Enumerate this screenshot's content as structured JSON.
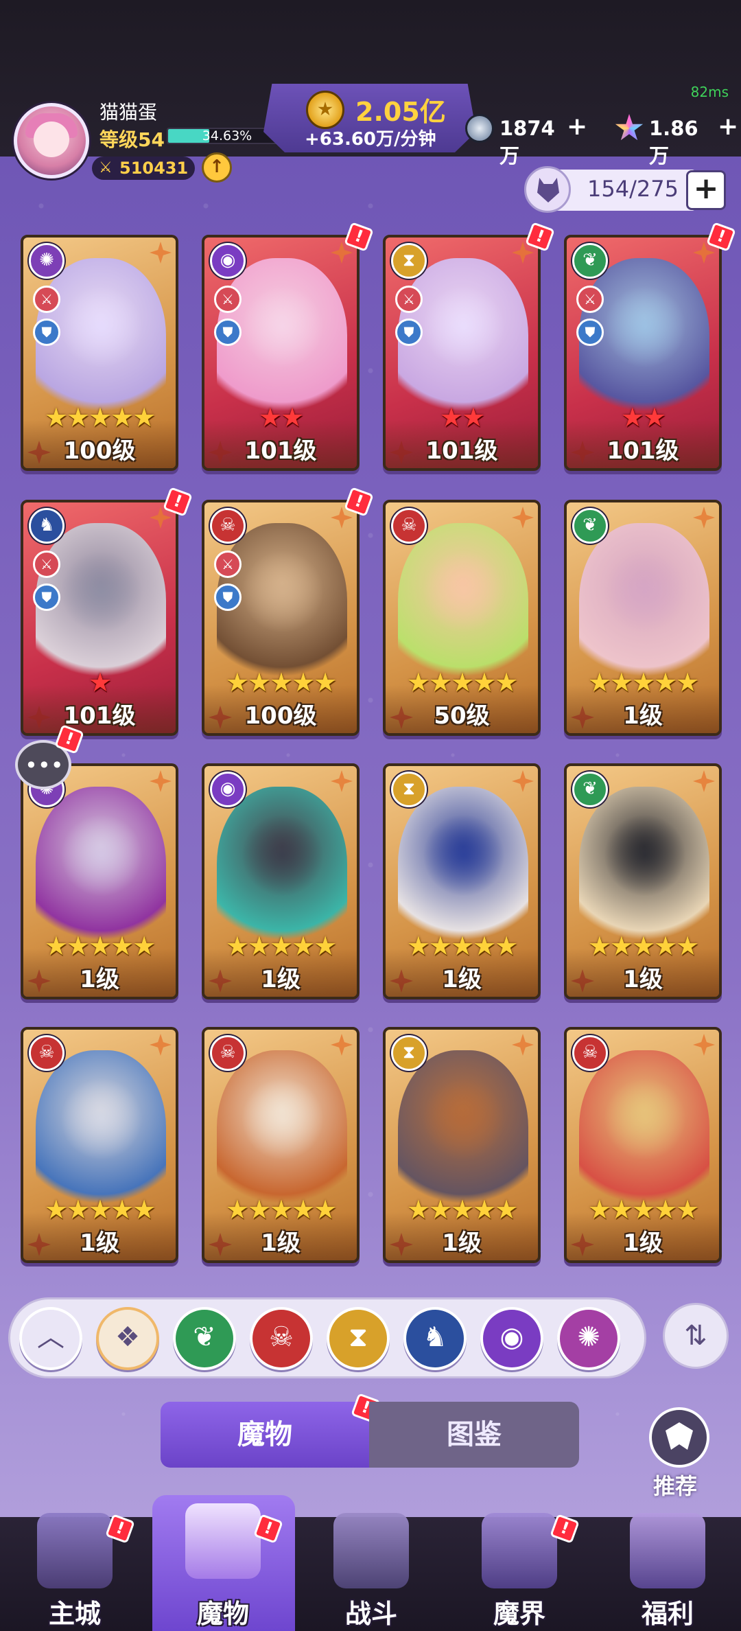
{
  "status": {
    "ping": "82ms"
  },
  "player": {
    "name": "猫猫蛋",
    "level": "等级54",
    "xp_percent": "34.63%",
    "xp_fraction": 0.3463,
    "power": "510431"
  },
  "gold": {
    "amount": "2.05亿",
    "rate": "+63.60万/分钟"
  },
  "resources": [
    {
      "name": "silver-coin",
      "value": "1874万"
    },
    {
      "name": "crystal-star",
      "value": "1.86万"
    }
  ],
  "collection": {
    "count": "154/275"
  },
  "monsters": [
    {
      "element": "vortex",
      "bg": "gold",
      "roles": [
        "atk",
        "def"
      ],
      "stars": 5,
      "star_color": "gold",
      "level": "100级",
      "badge": false
    },
    {
      "element": "eye",
      "bg": "red",
      "roles": [
        "atk",
        "def"
      ],
      "stars": 2,
      "star_color": "red",
      "level": "101级",
      "badge": true
    },
    {
      "element": "hourglass",
      "bg": "red",
      "roles": [
        "atk",
        "def"
      ],
      "stars": 2,
      "star_color": "red",
      "level": "101级",
      "badge": true
    },
    {
      "element": "leaf",
      "bg": "red",
      "roles": [
        "atk",
        "def"
      ],
      "stars": 2,
      "star_color": "red",
      "level": "101级",
      "badge": true
    },
    {
      "element": "dragon",
      "bg": "red",
      "roles": [
        "atk",
        "def"
      ],
      "stars": 1,
      "star_color": "red",
      "level": "101级",
      "badge": true
    },
    {
      "element": "skull",
      "bg": "gold",
      "roles": [
        "atk",
        "def"
      ],
      "stars": 5,
      "star_color": "gold",
      "level": "100级",
      "badge": true
    },
    {
      "element": "skull",
      "bg": "gold",
      "roles": [],
      "stars": 5,
      "star_color": "gold",
      "level": "50级",
      "badge": false
    },
    {
      "element": "leaf",
      "bg": "gold",
      "roles": [],
      "stars": 5,
      "star_color": "gold",
      "level": "1级",
      "badge": false
    },
    {
      "element": "vortex",
      "bg": "gold",
      "roles": [],
      "stars": 5,
      "star_color": "gold",
      "level": "1级",
      "badge": false
    },
    {
      "element": "eye",
      "bg": "gold",
      "roles": [],
      "stars": 5,
      "star_color": "gold",
      "level": "1级",
      "badge": false
    },
    {
      "element": "hourglass",
      "bg": "gold",
      "roles": [],
      "stars": 5,
      "star_color": "gold",
      "level": "1级",
      "badge": false
    },
    {
      "element": "leaf",
      "bg": "gold",
      "roles": [],
      "stars": 5,
      "star_color": "gold",
      "level": "1级",
      "badge": false
    },
    {
      "element": "skull",
      "bg": "gold",
      "roles": [],
      "stars": 5,
      "star_color": "gold",
      "level": "1级",
      "badge": false
    },
    {
      "element": "skull",
      "bg": "gold",
      "roles": [],
      "stars": 5,
      "star_color": "gold",
      "level": "1级",
      "badge": false
    },
    {
      "element": "hourglass",
      "bg": "gold",
      "roles": [],
      "stars": 5,
      "star_color": "gold",
      "level": "1级",
      "badge": false
    },
    {
      "element": "skull",
      "bg": "gold",
      "roles": [],
      "stars": 5,
      "star_color": "gold",
      "level": "1级",
      "badge": false
    }
  ],
  "filters": [
    "collapse-up-icon",
    "all-elements-icon",
    "leaf-element-icon",
    "skull-element-icon",
    "hourglass-element-icon",
    "dragon-element-icon",
    "eye-element-icon",
    "vortex-element-icon"
  ],
  "tabs": {
    "active": "魔物",
    "inactive": "图鉴"
  },
  "recommend": {
    "label": "推荐"
  },
  "nav": [
    {
      "label": "主城",
      "icon": "castle-icon",
      "active": false,
      "badge": true
    },
    {
      "label": "魔物",
      "icon": "monster-flame-icon",
      "active": true,
      "badge": true
    },
    {
      "label": "战斗",
      "icon": "shield-sword-icon",
      "active": false,
      "badge": false
    },
    {
      "label": "魔界",
      "icon": "demon-realm-icon",
      "active": false,
      "badge": true
    },
    {
      "label": "福利",
      "icon": "treasure-chest-icon",
      "active": false,
      "badge": false
    }
  ],
  "colors": {
    "accent": "#7b52d6",
    "gold_text": "#ffd23f",
    "badge": "#ff2c3d"
  }
}
